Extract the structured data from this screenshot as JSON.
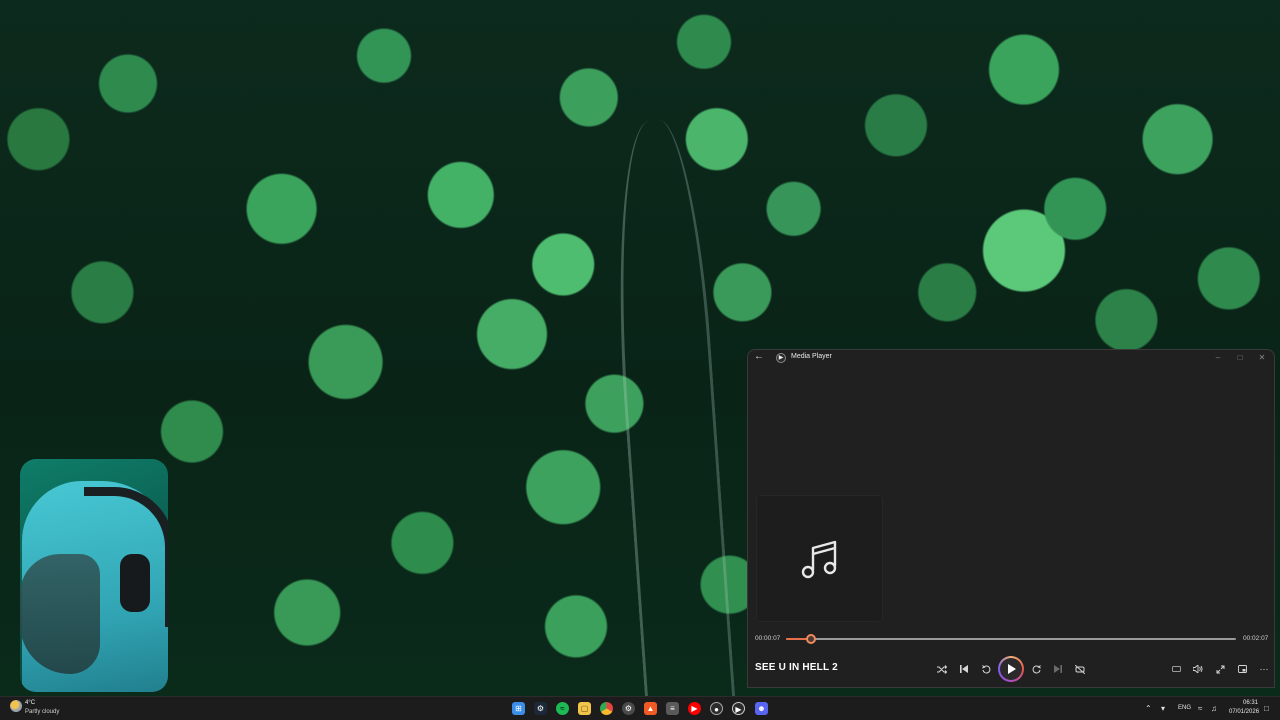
{
  "player": {
    "app_title": "Media Player",
    "song_title": "SEE U IN HELL 2",
    "elapsed": "00:00:07",
    "duration": "00:02:07",
    "progress_fraction": 0.055
  },
  "taskbar": {
    "weather_temp": "4°C",
    "weather_desc": "Partly cloudy",
    "language": "ENG",
    "clock_time": "06:31",
    "clock_date": "07/01/2026",
    "pinned_apps": [
      "start-icon",
      "steam-icon",
      "spotify-icon",
      "file-explorer-icon",
      "chrome-icon",
      "settings-icon",
      "brave-icon",
      "calculator-icon",
      "youtube-icon",
      "github-icon",
      "media-player-icon",
      "discord-icon"
    ]
  },
  "colors": {
    "accent_seek": "#e6704b",
    "player_bg": "#202020",
    "taskbar_bg": "#1c1c1c"
  }
}
